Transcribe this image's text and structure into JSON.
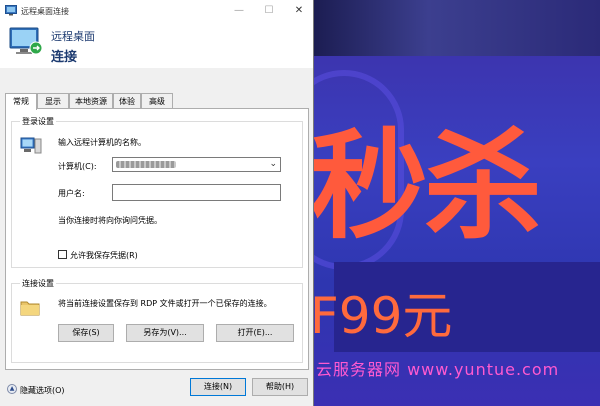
{
  "window": {
    "title": "远程桌面连接",
    "minimize": "—",
    "maximize": "☐",
    "close": "✕"
  },
  "header": {
    "line1": "远程桌面",
    "line2": "连接"
  },
  "tabs": [
    "常规",
    "显示",
    "本地资源",
    "体验",
    "高级"
  ],
  "login": {
    "legend": "登录设置",
    "prompt": "输入远程计算机的名称。",
    "computer_label": "计算机(C):",
    "computer_value_blurred": true,
    "user_label": "用户名:",
    "user_value": "",
    "hint": "当你连接时将向你询问凭据。",
    "save_creds_label": "允许我保存凭据(R)",
    "save_creds_checked": false
  },
  "connection": {
    "legend": "连接设置",
    "desc": "将当前连接设置保存到 RDP 文件或打开一个已保存的连接。",
    "save": "保存(S)",
    "save_as": "另存为(V)...",
    "open": "打开(E)..."
  },
  "footer": {
    "hide_options": "隐藏选项(O)",
    "connect": "连接(N)",
    "help": "帮助(H)"
  },
  "background": {
    "big_text": "秒杀",
    "price": "F99元",
    "watermark": "云服务器网 www.yuntue.com"
  }
}
